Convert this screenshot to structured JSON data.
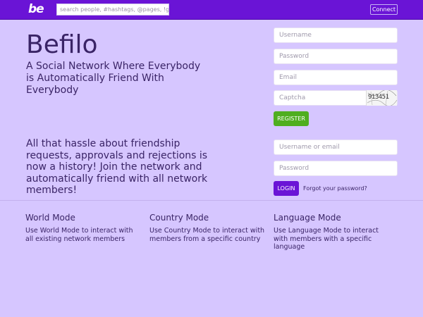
{
  "header": {
    "logo": "be",
    "search_placeholder": "search people, #hashtags, @pages, !groups",
    "connect_label": "Connect"
  },
  "hero": {
    "brand": "Befilo",
    "tagline": "A Social Network Where Everybody is Automatically Friend With Everybody",
    "pitch": "All that hassle about friendship requests, approvals and rejections is now a history! Join the network and automatically friend with all network members!"
  },
  "register": {
    "username_placeholder": "Username",
    "password_placeholder": "Password",
    "email_placeholder": "Email",
    "captcha_placeholder": "Captcha",
    "captcha_code": "913451",
    "register_label": "REGISTER"
  },
  "login": {
    "username_placeholder": "Username or email",
    "password_placeholder": "Password",
    "login_label": "LOGIN",
    "forgot_label": "Forgot your password?"
  },
  "modes": [
    {
      "title": "World Mode",
      "desc": "Use World Mode to interact with all existing network members"
    },
    {
      "title": "Country Mode",
      "desc": "Use Country Mode to interact with members from a specific country"
    },
    {
      "title": "Language Mode",
      "desc": "Use Language Mode to interact with members with a specific language"
    }
  ],
  "colors": {
    "accent": "#6a14d6",
    "register": "#4fae1f",
    "background": "#d6c6ff"
  }
}
